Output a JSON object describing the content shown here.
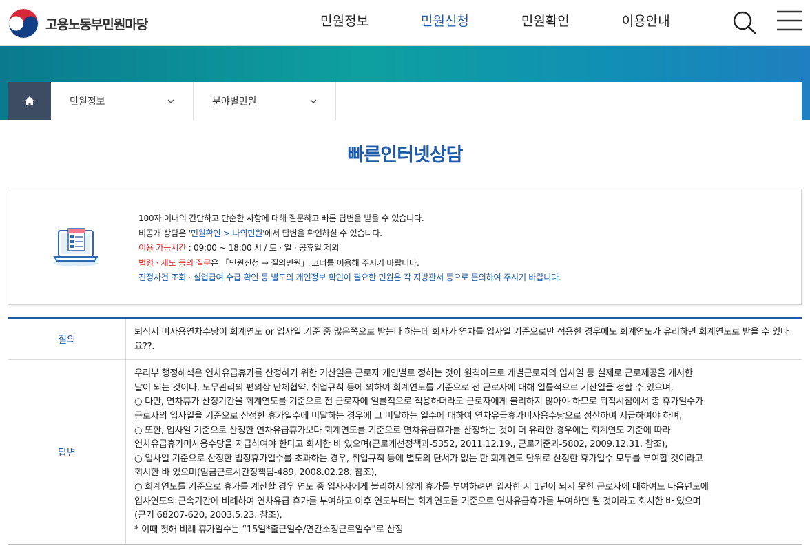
{
  "header": {
    "logo_text": "고용노동부민원마당",
    "nav": [
      "민원정보",
      "민원신청",
      "민원확인",
      "이용안내"
    ],
    "active_nav": "민원신청",
    "search_icon": "search-icon",
    "menu_icon": "hamburger-menu-icon"
  },
  "breadcrumb": {
    "home_icon": "home-icon",
    "items": [
      "민원정보",
      "분야별민원"
    ]
  },
  "page_title": "빠른인터넷상담",
  "info": {
    "line1": "100자 이내의 간단하고 단순한 사항에 대해 질문하고 빠른 답변을 받을 수 있습니다.",
    "line2_a": "비공개 상담은 '",
    "line2_link": "민원확인 > 나의민원",
    "line2_b": "'에서 답변을 확인하실 수 있습니다.",
    "line3_label": "이용 가능시간",
    "line3_text": " : 09:00 ~ 18:00 시 / 토 · 일 · 공휴일 제외",
    "line4_label": "법령 · 제도 등의 질문",
    "line4_text": "은 「민원신청 → 질의민원」 코너를 이용해 주시기 바랍니다.",
    "line5": "진정사건 조회 · 실업급여 수급 확인 등 별도의 개인정보 확인이 필요한 민원은 각 지방관서 등으로 문의하여 주시기 바랍니다."
  },
  "qa": {
    "question_label": "질의",
    "question": "퇴직시 미사용연차수당이 회계연도 or 입사일 기준 중 많은쪽으로 받는다 하는데 회사가 연차를 입사일 기준으로만 적용한 경우에도 회계연도가 유리하면 회계연도로 받을 수 있나요??.",
    "answer_label": "답변",
    "answer_lines": [
      "우리부 행정해석은 연차유급휴가를 산정하기 위한 기산일은 근로자 개인별로 정하는 것이 원칙이므로 개별근로자의 입사일 등 실제로 근로제공을 개시한",
      "날이 되는 것이나, 노무관리의 편의상 단체협약, 취업규칙 등에 의하여 회계연도를 기준으로 전 근로자에 대해 일률적으로 기산일을 정할 수 있으며,",
      "○ 다만, 연차휴가 산정기간을 회계연도를 기준으로 전 근로자에 일률적으로 적용하더라도 근로자에게 불리하지 않아야 하므로 퇴직시점에서 총 휴가일수가",
      "근로자의 입사일을 기준으로 산정한 휴가일수에 미달하는 경우에 그 미달하는 일수에 대하여 연차유급휴가미사용수당으로 정산하여 지급하여야 하며,",
      "○ 또한, 입사일 기준으로 산정한 연차유급휴가보다 회계연도를 기준으로 연차유급휴가를 산정하는 것이 더 유리한 경우에는 회계연도 기준에 따라",
      "연차유급휴가미사용수당을 지급하여야 한다고 회시한 바 있으며(근로개선정책과-5352, 2011.12.19., 근로기준과-5802, 2009.12.31. 참조),",
      "○ 입사일 기준으로 산정한 법정휴가일수를 초과하는 경우, 취업규칙 등에 별도의 단서가 없는 한 회계연도 단위로 산정한 휴가일수 모두를 부여할 것이라고",
      "회시한 바 있으며(임금근로시간정책팀-489, 2008.02.28. 참조),",
      "○ 회계연도를 기준으로 휴가를 계산할 경우 연도 중 입사자에게 불리하지 않게 휴가를 부여하려면 입사한 지 1년이 되지 못한 근로자에 대하여도 다음년도에",
      "입사연도의 근속기간에 비례하여 연차유급 휴가를 부여하고 이후 연도부터는 회계연도를 기준으로 연차유급휴가를 부여하면 될 것이라고 회시한 바 있으며",
      "(근기 68207-620, 2003.5.23. 참조),",
      "* 이때 첫해 비례 휴가일수는 “15일*출근일수/연간소정근로일수”로 산정"
    ]
  },
  "colors": {
    "accent": "#1e5aa8",
    "home_bg": "#3d4b63",
    "band_start": "#0a7a8f",
    "band_end": "#1f7fc0",
    "highlight_red": "#d62a2a"
  }
}
